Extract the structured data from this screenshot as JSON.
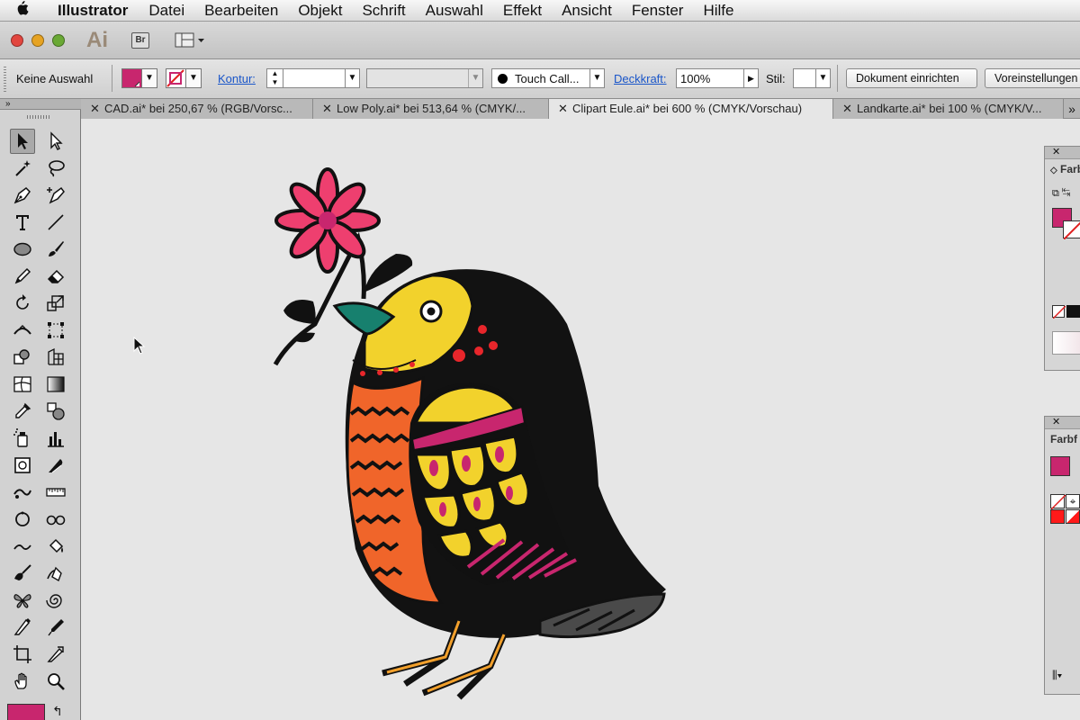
{
  "menubar": {
    "app_name": "Illustrator",
    "items": [
      "Datei",
      "Bearbeiten",
      "Objekt",
      "Schrift",
      "Auswahl",
      "Effekt",
      "Ansicht",
      "Fenster",
      "Hilfe"
    ]
  },
  "appbar": {
    "logo": "Ai",
    "bridge_label": "Br"
  },
  "controlbar": {
    "selection_status": "Keine Auswahl",
    "stroke_label": "Kontur:",
    "brush_label": "Touch Call...",
    "opacity_label": "Deckkraft:",
    "opacity_value": "100%",
    "style_label": "Stil:",
    "document_setup_button": "Dokument einrichten",
    "preferences_button": "Voreinstellungen",
    "fill_color": "#c8266e"
  },
  "tabs": [
    {
      "label": "CAD.ai* bei 250,67 % (RGB/Vorsc...",
      "active": false
    },
    {
      "label": "Low Poly.ai* bei 513,64 % (CMYK/...",
      "active": false
    },
    {
      "label": "Clipart Eule.ai* bei 600 % (CMYK/Vorschau)",
      "active": true
    },
    {
      "label": "Landkarte.ai* bei 100 % (CMYK/V...",
      "active": false
    }
  ],
  "panels": {
    "color_panel_title": "Farb",
    "swatches_panel_title": "Farbf"
  },
  "colors": {
    "fill": "#c8266e",
    "bird_body": "#121212",
    "head": "#f2d22c",
    "breast": "#f0652a",
    "flower": "#ee3f6f",
    "beak": "#17806e"
  }
}
